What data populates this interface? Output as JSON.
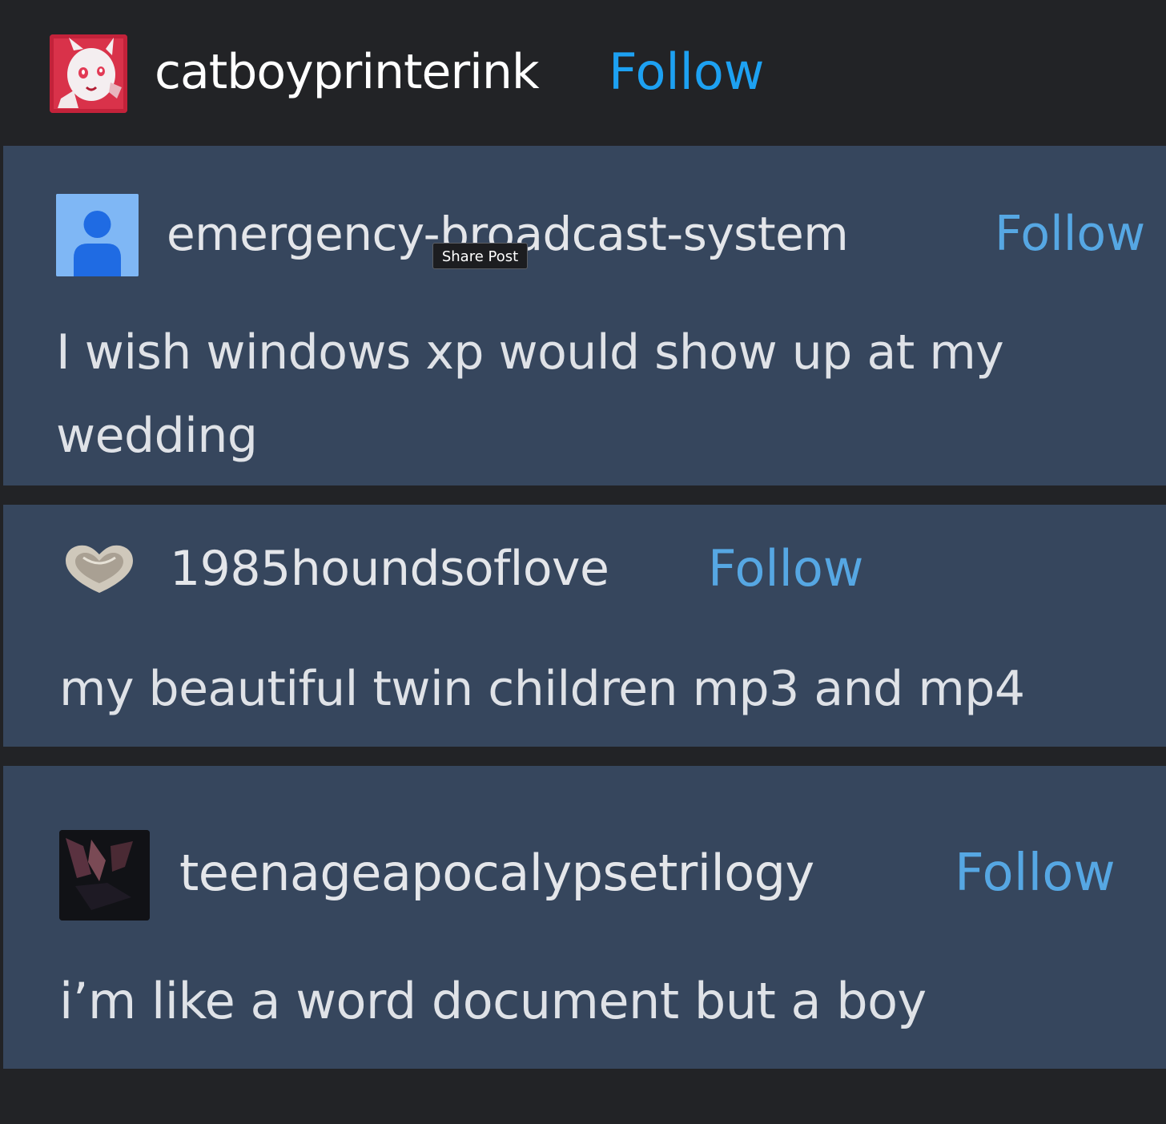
{
  "header": {
    "username": "catboyprinterink",
    "follow_label": "Follow"
  },
  "posts": [
    {
      "username": "emergency-broadcast-system",
      "follow_label": "Follow",
      "text": "I wish windows xp would show up at my wedding"
    },
    {
      "username": "1985houndsoflove",
      "follow_label": "Follow",
      "text": "my beautiful twin children mp3 and mp4"
    },
    {
      "username": "teenageapocalypsetrilogy",
      "follow_label": "Follow",
      "text": "i’m like a word document but a boy"
    }
  ],
  "tooltip": {
    "label": "Share Post"
  },
  "colors": {
    "page_background": "#222326",
    "card_background": "#36465d",
    "header_follow": "#1da1f2",
    "post_follow": "#56a7e3"
  },
  "icons": {
    "header_avatar": "anime-character-avatar",
    "post_1_avatar": "default-user-avatar",
    "post_2_avatar": "heart-dish-avatar",
    "post_3_avatar": "dark-photo-avatar"
  }
}
